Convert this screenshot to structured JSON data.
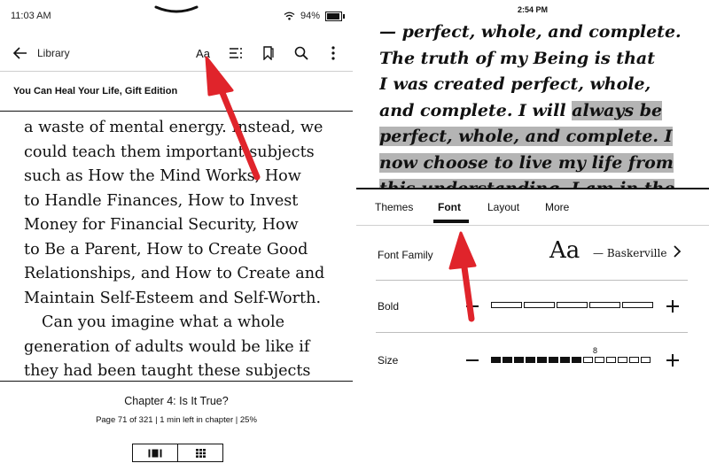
{
  "left": {
    "status": {
      "time": "11:03 AM",
      "battery": "94%",
      "battery_level": 0.94
    },
    "toolbar": {
      "back_label": "Library",
      "icons": [
        "back-arrow-icon",
        "font-settings-icon",
        "contents-icon",
        "bookmark-icon",
        "search-icon",
        "more-icon"
      ],
      "font_settings_label": "Aa"
    },
    "book_title": "You Can Heal Your Life, Gift Edition",
    "text_lines": [
      "a waste of mental energy. Instead, we",
      "could teach them important subjects",
      "such as How the Mind Works, How",
      "to Handle Finances, How to Invest",
      "Money for Financial Security, How",
      "to Be a Parent, How to Create Good",
      "Relationships, and How to Create and",
      "Maintain Self-Esteem and Self-Worth."
    ],
    "text_lines_2": [
      "Can you imagine what a whole",
      "generation of adults would be like if",
      "they had been taught these subjects"
    ],
    "chapter": "Chapter 4: Is It True?",
    "page_info": "Page 71 of 321 | 1 min left in chapter | 25%"
  },
  "right": {
    "status": {
      "time": "2:54 PM"
    },
    "reading": {
      "line1": "— perfect, whole, and complete.",
      "line2": "The truth of my Being is that",
      "line3": "I was created perfect, whole,",
      "line4_plain": "and complete. I will ",
      "line4_hl": "always be",
      "line5_hl": "perfect, whole, and complete. I",
      "line6_hl": "now choose to live my life from",
      "line7_hl": "this understanding. I am in the"
    },
    "tabs": [
      "Themes",
      "Font",
      "Layout",
      "More"
    ],
    "active_tab": "Font",
    "font_family": {
      "label": "Font Family",
      "sample": "Aa",
      "name": "— Baskerville"
    },
    "bold": {
      "label": "Bold",
      "level": 0,
      "steps": 5
    },
    "size": {
      "label": "Size",
      "value": "8",
      "level": 8,
      "steps": 14
    }
  },
  "colors": {
    "highlight": "#b4b4b4",
    "arrow": "#e0242b",
    "text": "#111111"
  }
}
